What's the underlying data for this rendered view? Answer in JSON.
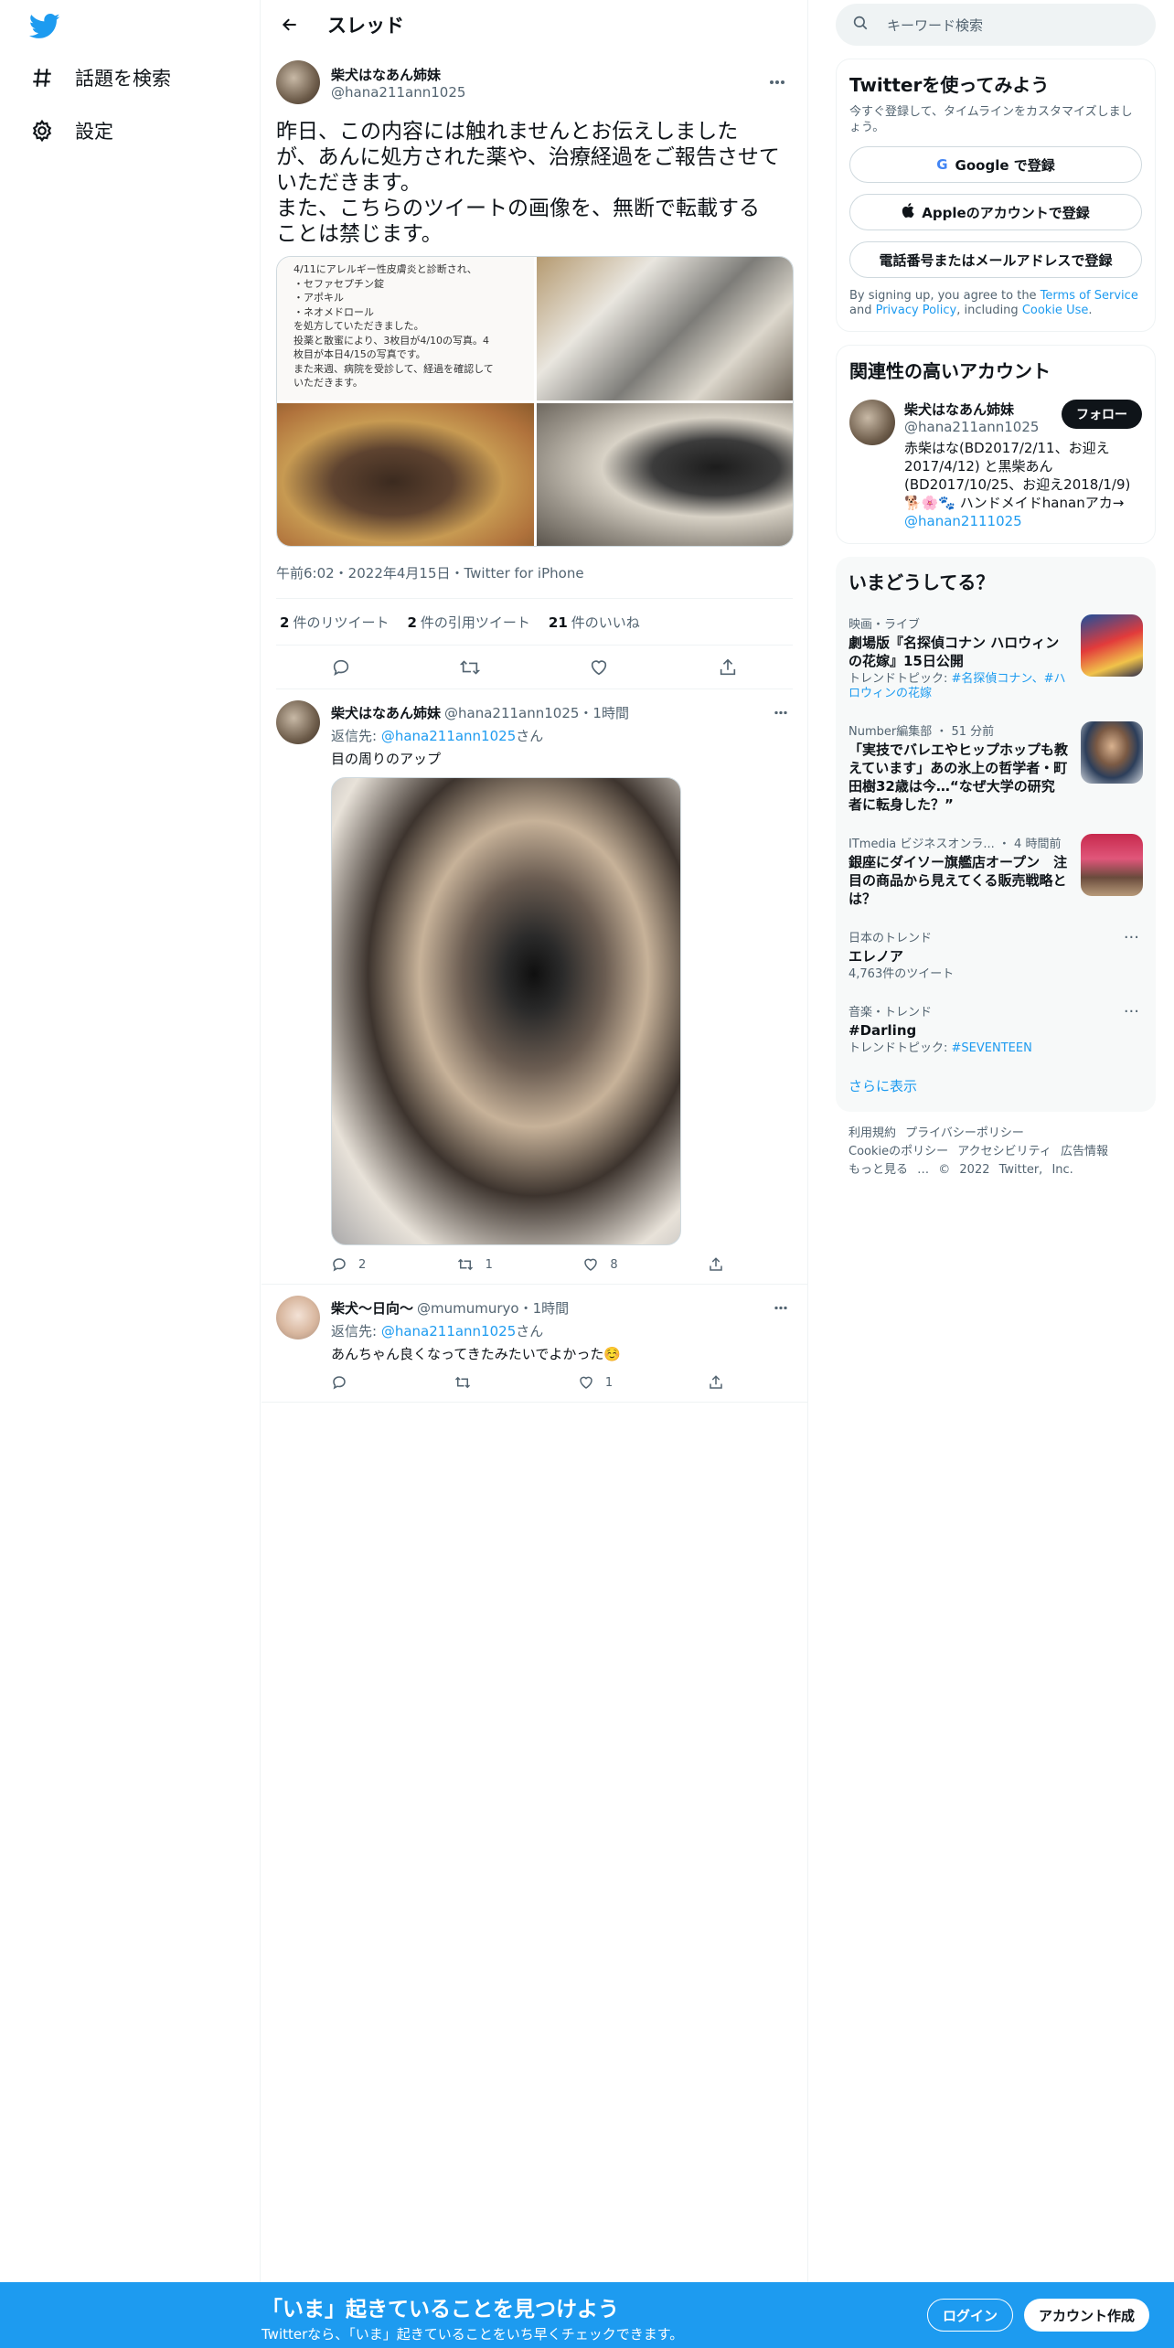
{
  "nav": {
    "items": [
      {
        "label": "話題を検索",
        "icon": "hash-icon"
      },
      {
        "label": "設定",
        "icon": "gear-icon"
      }
    ]
  },
  "header": {
    "title": "スレッド"
  },
  "focus": {
    "name": "柴犬はなあん姉妹",
    "handle": "@hana211ann1025",
    "text": "昨日、この内容には触れませんとお伝えしました\nが、あんに処方された薬や、治療経過をご報告させて\nいただきます。\nまた、こちらのツイートの画像を、無断で転載する\nことは禁じます。",
    "image_text": "4/11にアレルギー性皮膚炎と診断され、\n・セファセプチン錠\n・アポキル\n・ネオメドロール\nを処方していただきました。\n投薬と散蜜により、3枚目が4/10の写真。4\n枚目が本日4/15の写真です。\nまた来週、病院を受診して、経過を確認して\nいただきます。",
    "meta": "午前6:02・2022年4月15日・Twitter for iPhone",
    "retweets_count": "2",
    "retweets_label": "件のリツイート",
    "quotes_count": "2",
    "quotes_label": "件の引用ツイート",
    "likes_count": "21",
    "likes_label": "件のいいね"
  },
  "replies": [
    {
      "name": "柴犬はなあん姉妹",
      "handle": "@hana211ann1025・1時間",
      "reply_prefix": "返信先: ",
      "reply_to": "@hana211ann1025",
      "reply_suffix": "さん",
      "text": "目の周りのアップ",
      "reply_count": "2",
      "retweet_count": "1",
      "like_count": "8"
    },
    {
      "name": "柴犬～日向～",
      "handle": "@mumumuryo・1時間",
      "reply_prefix": "返信先: ",
      "reply_to": "@hana211ann1025",
      "reply_suffix": "さん",
      "text": "あんちゃん良くなってきたみたいでよかった☺️",
      "reply_count": "",
      "retweet_count": "",
      "like_count": "1"
    }
  ],
  "search": {
    "placeholder": "キーワード検索"
  },
  "signup": {
    "title": "Twitterを使ってみよう",
    "subtitle": "今すぐ登録して、タイムラインをカスタマイズしましょう。",
    "google": "Google で登録",
    "apple": "Appleのアカウントで登録",
    "phone": "電話番号またはメールアドレスで登録",
    "fine_1": "By signing up, you agree to the ",
    "tos": "Terms of Service",
    "fine_2": " and ",
    "privacy": "Privacy Policy",
    "fine_3": ", including ",
    "cookie": "Cookie Use",
    "fine_4": "."
  },
  "related": {
    "title": "関連性の高いアカウント",
    "name": "柴犬はなあん姉妹",
    "handle": "@hana211ann1025",
    "follow": "フォロー",
    "bio": "赤柴はな(BD2017/2/11、お迎え2017/4/12) と黒柴あん(BD2017/10/25、お迎え2018/1/9)🐕🌸🐾 ハンドメイドhananアカ→",
    "bio_link": "@hanan2111025"
  },
  "trends": {
    "title": "いまどうしてる？",
    "items": [
      {
        "cat": "映画・ライブ",
        "title": "劇場版『名探偵コナン ハロウィンの花嫁』15日公開",
        "topic_prefix": "トレンドトピック: ",
        "topic": "#名探偵コナン、#ハロウィンの花嫁"
      },
      {
        "cat": "Number編集部 ・ 51 分前",
        "title": "「実技でバレエやヒップホップも教えています」あの氷上の哲学者・町田樹32歳は今…“なぜ大学の研究者に転身した？”"
      },
      {
        "cat": "ITmedia ビジネスオンラ... ・ 4 時間前",
        "title": "銀座にダイソー旗艦店オープン　注目の商品から見えてくる販売戦略とは？"
      },
      {
        "cat": "日本のトレンド",
        "title": "エレノア",
        "count": "4,763件のツイート"
      },
      {
        "cat": "音楽・トレンド",
        "title": "#Darling",
        "topic_prefix": "トレンドトピック: ",
        "topic": "#SEVENTEEN"
      }
    ],
    "more": "さらに表示"
  },
  "footer": {
    "line1": "利用規約 プライバシーポリシー",
    "line2": "Cookieのポリシー アクセシビリティ 広告情報",
    "line3": "もっと見る … © 2022 Twitter, Inc."
  },
  "bottom_bar": {
    "title": "「いま」起きていることを見つけよう",
    "subtitle": "Twitterなら、「いま」起きていることをいち早くチェックできます。",
    "login": "ログイン",
    "signup": "アカウント作成"
  },
  "colors": {
    "accent": "#1d9bf0",
    "text": "#0f1419",
    "muted": "#536471"
  }
}
